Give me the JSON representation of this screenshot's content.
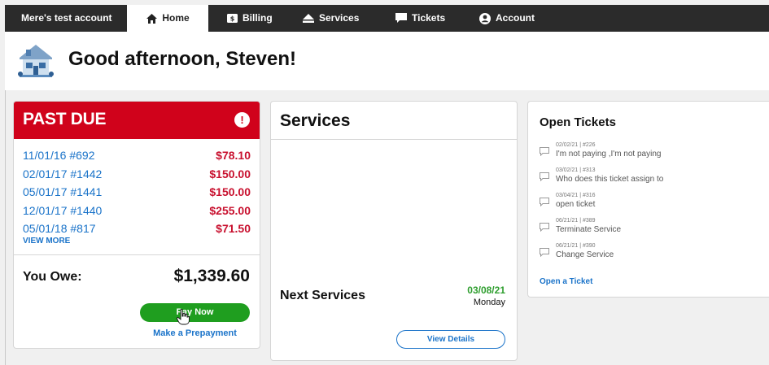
{
  "nav": {
    "account_name": "Mere's test account",
    "items": [
      {
        "label": "Home",
        "icon": "home-icon"
      },
      {
        "label": "Billing",
        "icon": "billing-icon"
      },
      {
        "label": "Services",
        "icon": "services-icon"
      },
      {
        "label": "Tickets",
        "icon": "tickets-icon"
      },
      {
        "label": "Account",
        "icon": "account-icon"
      }
    ],
    "active": "Home"
  },
  "header": {
    "greeting": "Good afternoon, Steven!"
  },
  "past_due": {
    "title": "PAST DUE",
    "alert": "!",
    "invoices": [
      {
        "invoice": "11/01/16 #692",
        "amount": "$78.10"
      },
      {
        "invoice": "02/01/17 #1442",
        "amount": "$150.00"
      },
      {
        "invoice": "05/01/17 #1441",
        "amount": "$150.00"
      },
      {
        "invoice": "12/01/17 #1440",
        "amount": "$255.00"
      },
      {
        "invoice": "05/01/18 #817",
        "amount": "$71.50"
      }
    ],
    "view_more": "VIEW MORE",
    "you_owe_label": "You Owe:",
    "you_owe_amount": "$1,339.60",
    "pay_now": "Pay Now",
    "prepayment": "Make a Prepayment"
  },
  "services": {
    "title": "Services",
    "next_label": "Next Services",
    "next_date": "03/08/21",
    "next_day": "Monday",
    "view_details": "View Details"
  },
  "tickets": {
    "title": "Open Tickets",
    "items": [
      {
        "meta": "02/02/21 | #226",
        "text": "I'm not paying ,I'm not paying"
      },
      {
        "meta": "03/02/21 | #313",
        "text": "Who does this ticket assign to"
      },
      {
        "meta": "03/04/21 | #316",
        "text": "open ticket"
      },
      {
        "meta": "06/21/21 | #389",
        "text": "Terminate Service"
      },
      {
        "meta": "06/21/21 | #390",
        "text": "Change Service"
      }
    ],
    "open_ticket": "Open a Ticket"
  },
  "colors": {
    "nav_bg": "#2b2b2b",
    "past_due_red": "#d0021b",
    "link_blue": "#1a73c9",
    "pay_green": "#1f9e1f"
  }
}
